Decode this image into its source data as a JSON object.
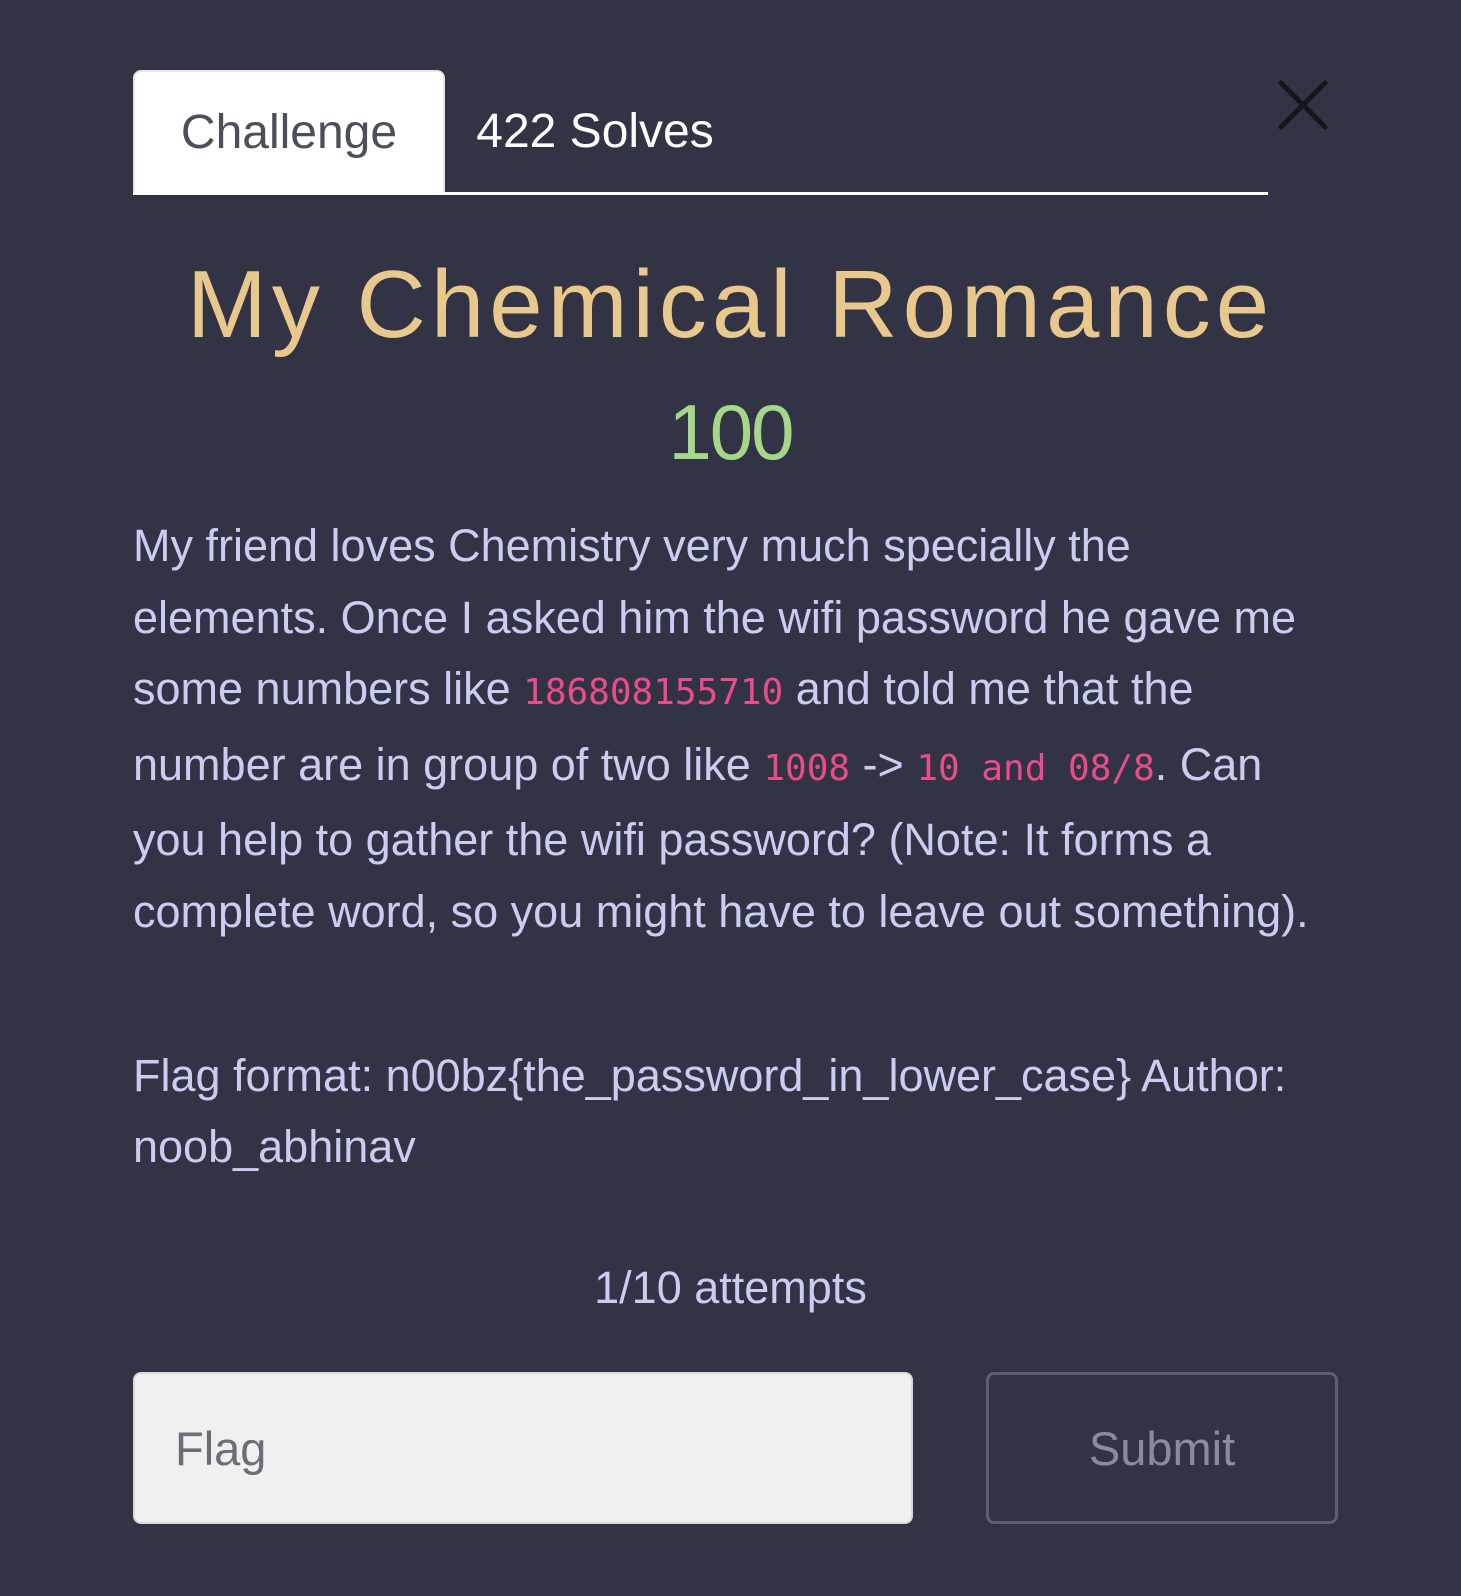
{
  "tabs": [
    {
      "label": "Challenge",
      "active": true
    },
    {
      "label": "422 Solves",
      "active": false
    }
  ],
  "close_icon": "close-icon",
  "challenge": {
    "title": "My Chemical Romance",
    "points": "100",
    "description": {
      "part1": "My friend loves Chemistry very much specially the elements. Once I asked him the wifi password he gave me some numbers like ",
      "code1": "186808155710",
      "part2": " and told me that the number are in group of two like ",
      "code2": "1008",
      "part3": " -> ",
      "code3": "10 and 08/8",
      "part4": ". Can you help to gather the wifi password? (Note: It forms a complete word, so you might have to leave out something)."
    },
    "flag_format": "Flag format: n00bz{the_password_in_lower_case} Author: noob_abhinav",
    "attempts": "1/10 attempts"
  },
  "form": {
    "flag_placeholder": "Flag",
    "flag_value": "",
    "submit_label": "Submit"
  },
  "colors": {
    "background": "#323446",
    "title": "#e8c88c",
    "points": "#a5d68a",
    "text": "#c9cdf2",
    "code": "#e84d8a"
  }
}
